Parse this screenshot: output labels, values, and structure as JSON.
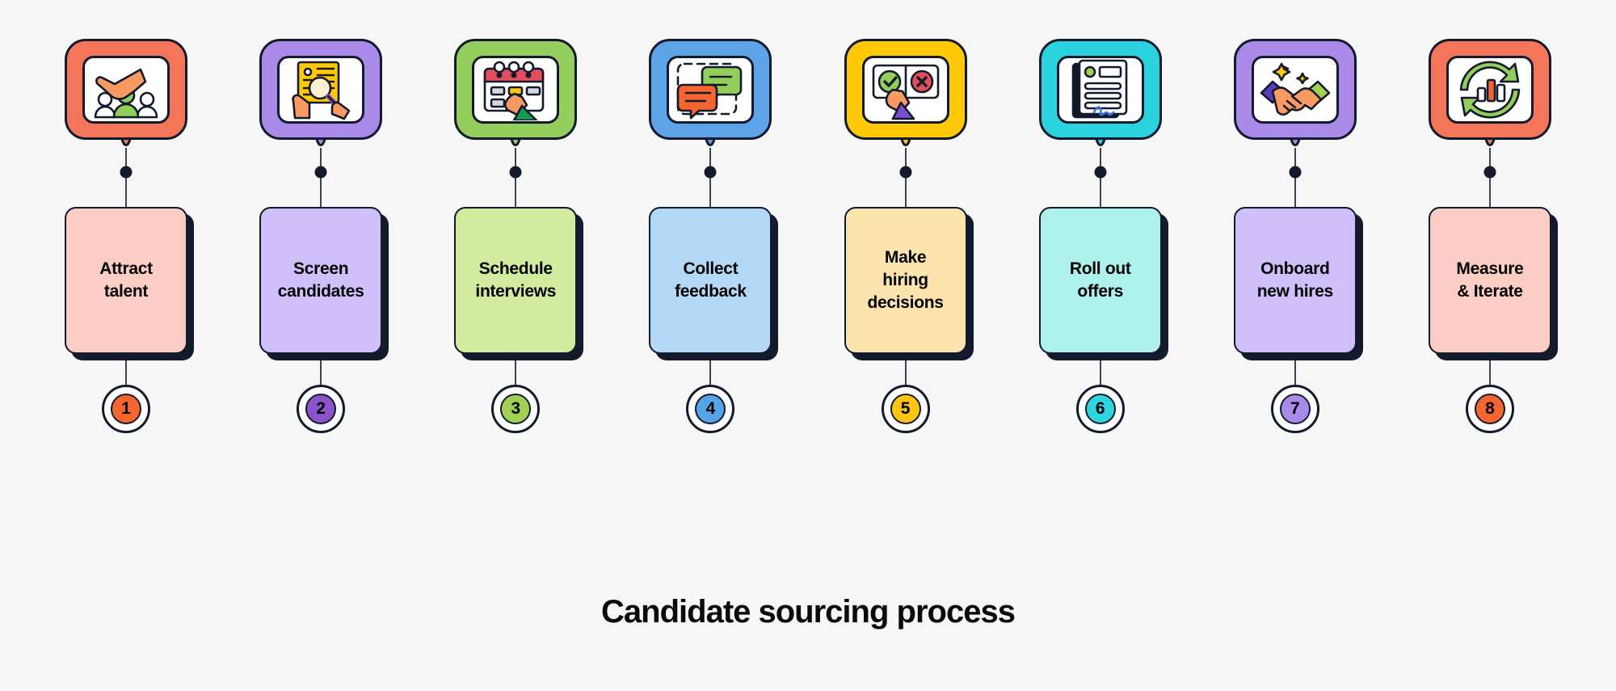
{
  "title": "Candidate sourcing process",
  "background_color": "#f6f6f6",
  "outline_color": "#121a2b",
  "steps": [
    {
      "number": "1",
      "label": "Attract\ntalent",
      "icon": "hand-picking-candidate-icon",
      "badge_color": "#f4765a",
      "card_color": "#fccdc4",
      "number_color": "#f4652f"
    },
    {
      "number": "2",
      "label": "Screen\ncandidates",
      "icon": "resume-magnifier-icon",
      "badge_color": "#a98ae8",
      "card_color": "#cfc0fb",
      "number_color": "#8b54c9"
    },
    {
      "number": "3",
      "label": "Schedule\ninterviews",
      "icon": "calendar-hand-icon",
      "badge_color": "#94ce5d",
      "card_color": "#d2eb9e",
      "number_color": "#a0d155"
    },
    {
      "number": "4",
      "label": "Collect\nfeedback",
      "icon": "speech-bubbles-icon",
      "badge_color": "#5ca3e8",
      "card_color": "#b4d8f5",
      "number_color": "#55a4e6"
    },
    {
      "number": "5",
      "label": "Make\nhiring\ndecisions",
      "icon": "approve-reject-icon",
      "badge_color": "#ffc907",
      "card_color": "#fbe3ae",
      "number_color": "#fdc513"
    },
    {
      "number": "6",
      "label": "Roll out\noffers",
      "icon": "signed-document-icon",
      "badge_color": "#2ad3dd",
      "card_color": "#aef0ec",
      "number_color": "#2fd4dd"
    },
    {
      "number": "7",
      "label": "Onboard\nnew hires",
      "icon": "handshake-icon",
      "badge_color": "#a98ae8",
      "card_color": "#cfc0fb",
      "number_color": "#aa8ae8"
    },
    {
      "number": "8",
      "label": "Measure\n& Iterate",
      "icon": "refresh-chart-icon",
      "badge_color": "#f4765a",
      "card_color": "#fccdc4",
      "number_color": "#f4652f"
    }
  ]
}
